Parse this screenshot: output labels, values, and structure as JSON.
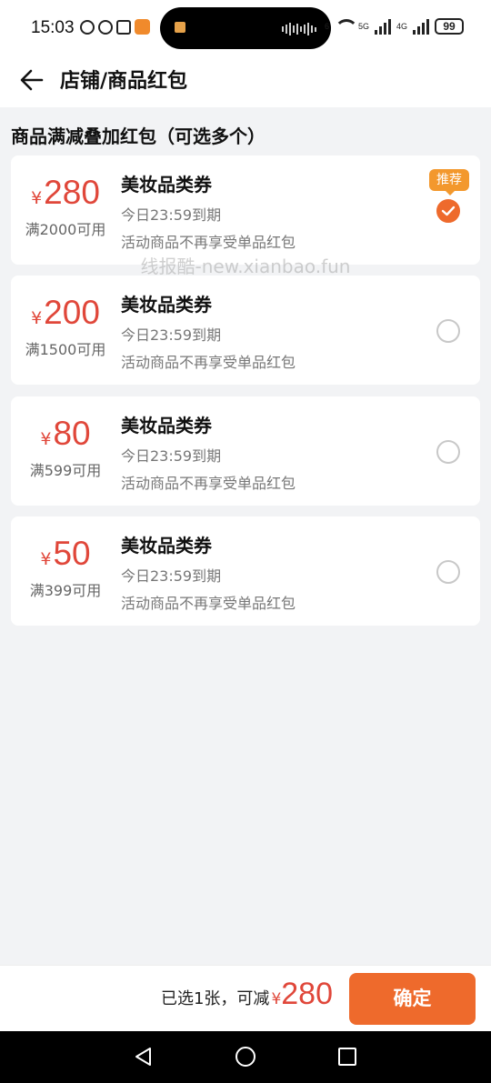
{
  "status_bar": {
    "time": "15:03",
    "sig1_label": "6",
    "sig2_label": "5G",
    "sig3_label": "4G",
    "battery": "99"
  },
  "header": {
    "title": "店铺/商品红包"
  },
  "section_title": "商品满减叠加红包（可选多个）",
  "watermark": "线报酷-new.xianbao.fun",
  "currency_symbol": "¥",
  "recommend_badge": "推荐",
  "coupons": [
    {
      "amount": "280",
      "threshold": "满2000可用",
      "name": "美妆品类券",
      "expiry": "今日23:59到期",
      "note": "活动商品不再享受单品红包",
      "selected": true
    },
    {
      "amount": "200",
      "threshold": "满1500可用",
      "name": "美妆品类券",
      "expiry": "今日23:59到期",
      "note": "活动商品不再享受单品红包",
      "selected": false
    },
    {
      "amount": "80",
      "threshold": "满599可用",
      "name": "美妆品类券",
      "expiry": "今日23:59到期",
      "note": "活动商品不再享受单品红包",
      "selected": false
    },
    {
      "amount": "50",
      "threshold": "满399可用",
      "name": "美妆品类券",
      "expiry": "今日23:59到期",
      "note": "活动商品不再享受单品红包",
      "selected": false
    }
  ],
  "summary": {
    "text": "已选1张，可减",
    "amount": "280"
  },
  "confirm_label": "确定",
  "colors": {
    "accent": "#ee6a2c",
    "price": "#e0473a",
    "badge": "#f3982d",
    "background": "#f2f3f5"
  }
}
